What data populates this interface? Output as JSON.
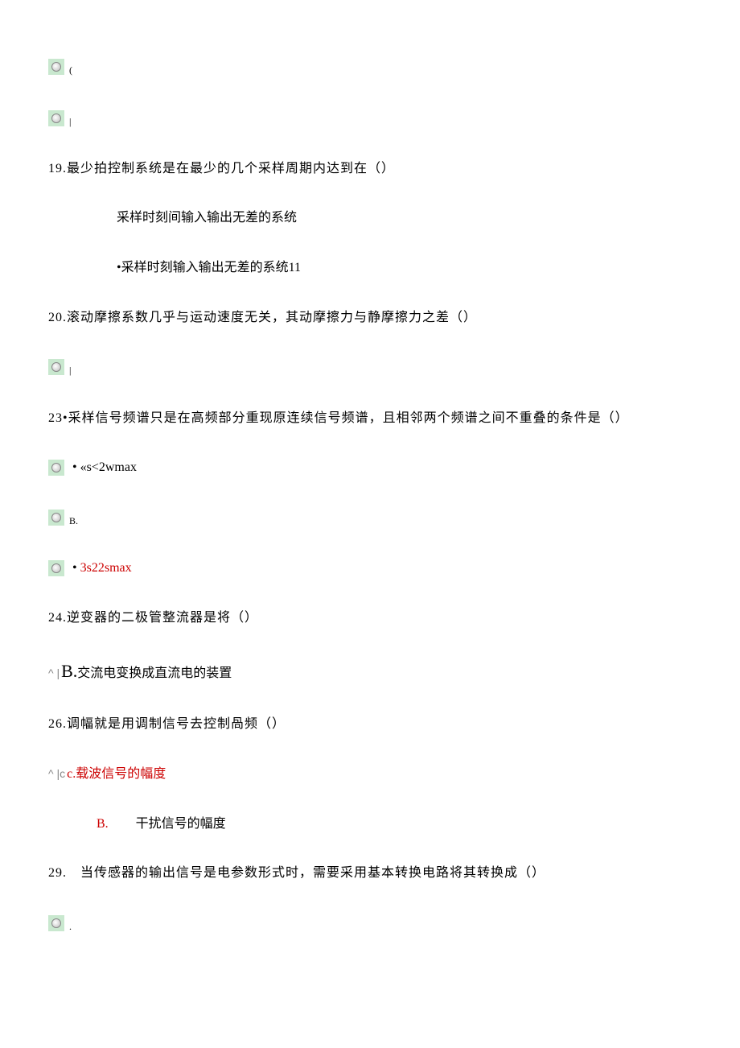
{
  "opt_c_trail": "(",
  "opt_l_trail": "|",
  "q19": {
    "text": "19.最少拍控制系统是在最少的几个采样周期内达到在（）",
    "a1": "采样时刻间输入输出无差的系统",
    "a2": "•采样时刻输入输出无差的系统11"
  },
  "q20": {
    "text": "20.滚动摩擦系数几乎与运动速度无关，其动摩擦力与静摩擦力之差（）",
    "trail": "|"
  },
  "q23": {
    "text": "23•采样信号频谱只是在高频部分重现原连续信号频谱，且相邻两个频谱之间不重叠的条件是（）",
    "opt_a": "«s<2wmax",
    "opt_b": "B.",
    "opt_c": "3s22smax"
  },
  "q24": {
    "text": "24.逆变器的二极管整流器是将（）",
    "prefix": "^ |",
    "label": "B.",
    "answer": "交流电变换成直流电的装置"
  },
  "q26": {
    "text": "26.调幅就是用调制信号去控制咼频（）",
    "prefix_a": "^ |c",
    "opt_a": "c.载波信号的幅度",
    "opt_b_label": "B.",
    "opt_b_text": "干扰信号的幅度"
  },
  "q29": {
    "text": "29.　当传感器的输出信号是电参数形式时，需要采用基本转换电路将其转换成（）",
    "trail": "."
  }
}
